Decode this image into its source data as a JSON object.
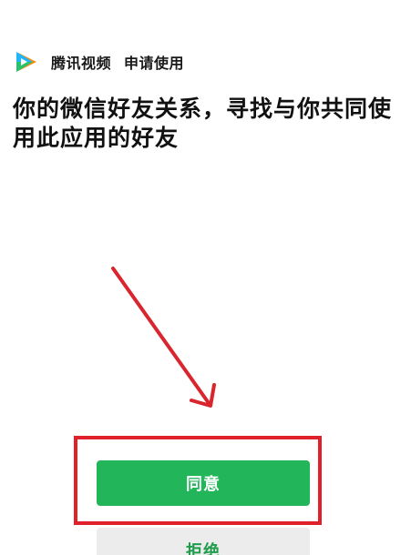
{
  "app": {
    "name": "腾讯视频",
    "request_text": "申请使用",
    "logo_icon": "tencent-video-play-icon",
    "logo_colors": {
      "top": "#1fb6ff",
      "bottom": "#2cc16b",
      "accent": "#ff8a00"
    }
  },
  "heading": "你的微信好友关系，寻找与你共同使用此应用的好友",
  "buttons": {
    "agree_label": "同意",
    "reject_label": "拒绝"
  },
  "annotation": {
    "arrow_color": "#d9262e",
    "box_color": "#e0202a"
  },
  "colors": {
    "primary_green": "#22b55a",
    "secondary_bg": "#ececec",
    "secondary_text": "#1f9d4c"
  }
}
